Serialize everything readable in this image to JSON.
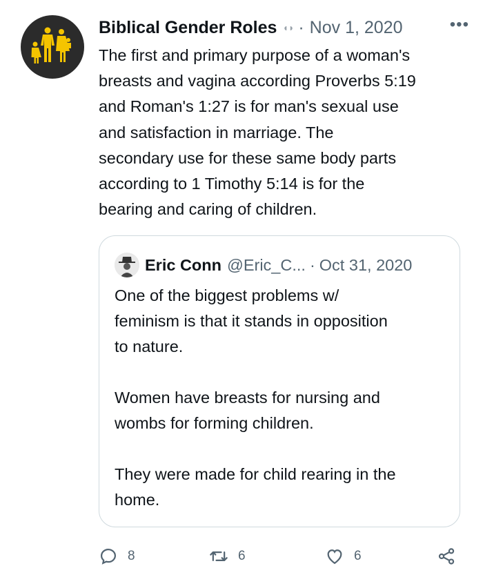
{
  "tweet": {
    "author_name": "Biblical Gender Roles",
    "date": "Nov 1, 2020",
    "separator": "·",
    "more_label": "•••",
    "text": "The first and primary purpose of a woman's\nbreasts and vagina according Proverbs 5:19\nand Roman's 1:27 is for man's sexual use\nand satisfaction in marriage.  The\nsecondary use for these same body parts\naccording to 1 Timothy 5:14 is for the\nbearing and caring of children.",
    "avatar_icon": "family-icon",
    "avatar_color": "#f5c400"
  },
  "quoted_tweet": {
    "author_name": "Eric Conn",
    "handle": "@Eric_C...",
    "separator": "·",
    "date": "Oct 31, 2020",
    "text": "One of the biggest problems w/\nfeminism is that it stands in opposition\nto nature.\n\nWomen have breasts for nursing and\nwombs for forming children.\n\nThey were made for child rearing in the\nhome."
  },
  "actions": {
    "reply_count": "8",
    "retweet_count": "6",
    "like_count": "6",
    "reply_icon": "reply-icon",
    "retweet_icon": "retweet-icon",
    "like_icon": "heart-icon",
    "share_icon": "share-icon"
  },
  "colors": {
    "text_primary": "#0f1419",
    "text_secondary": "#536471",
    "border": "#cfd9de"
  }
}
